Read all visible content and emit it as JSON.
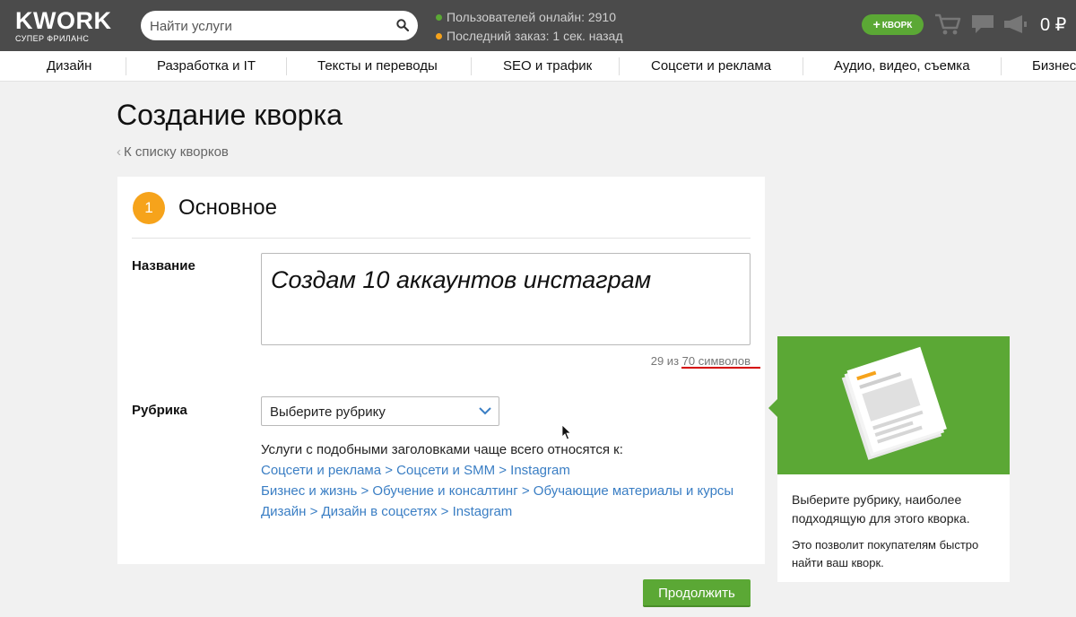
{
  "header": {
    "logo": "KWORK",
    "logo_sub": "СУПЕР ФРИЛАНС",
    "search_placeholder": "Найти услуги",
    "online_text": "Пользователей онлайн: 2910",
    "last_order_text": "Последний заказ: 1 сек. назад",
    "kwork_button": "КВОРК",
    "balance": "0 ₽",
    "colors": {
      "online_dot": "#5ba835",
      "order_dot": "#f6a31b",
      "accent_green": "#5ba835"
    }
  },
  "categories": [
    "Дизайн",
    "Разработка и IT",
    "Тексты и переводы",
    "SEO и трафик",
    "Соцсети и реклама",
    "Аудио, видео, съемка",
    "Бизнес"
  ],
  "page": {
    "title": "Создание кворка",
    "back_link": "К списку кворков"
  },
  "form": {
    "step_number": "1",
    "section_title": "Основное",
    "name_label": "Название",
    "name_value": "Создам 10 аккаунтов инстаграм",
    "counter_current": "29 из",
    "counter_max": "70 символов",
    "rubric_label": "Рубрика",
    "rubric_selected": "Выберите рубрику",
    "hint": "Услуги с подобными заголовками чаще всего относятся к:",
    "suggestions": [
      "Соцсети и реклама > Соцсети и SMM > Instagram",
      "Бизнес и жизнь > Обучение и консалтинг > Обучающие материалы и курсы",
      "Дизайн > Дизайн в соцсетях > Instagram"
    ],
    "continue_button": "Продолжить"
  },
  "tip": {
    "text1": "Выберите рубрику, наиболее подходящую для этого кворка.",
    "text2": "Это позволит покупателям быстро найти ваш кворк."
  }
}
